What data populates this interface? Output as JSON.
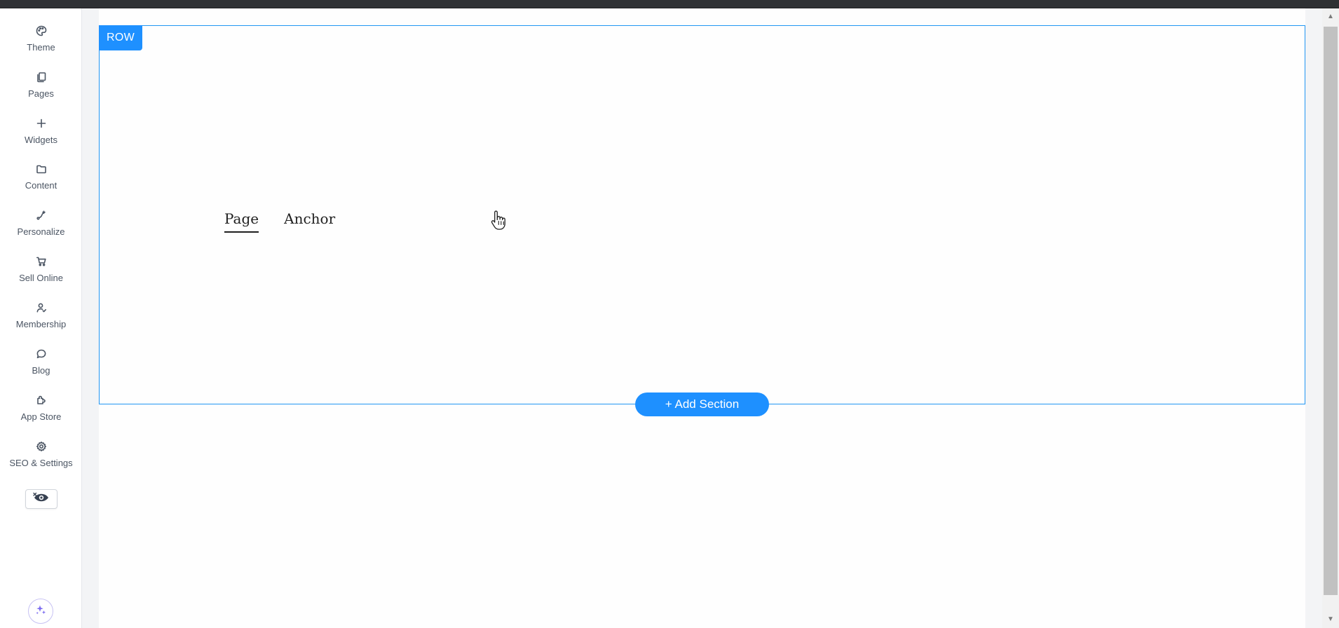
{
  "sidebar": {
    "items": [
      {
        "label": "Theme",
        "icon": "palette-icon"
      },
      {
        "label": "Pages",
        "icon": "pages-icon"
      },
      {
        "label": "Widgets",
        "icon": "plus-icon"
      },
      {
        "label": "Content",
        "icon": "folder-icon"
      },
      {
        "label": "Personalize",
        "icon": "personalize-icon"
      },
      {
        "label": "Sell Online",
        "icon": "cart-icon"
      },
      {
        "label": "Membership",
        "icon": "user-check-icon"
      },
      {
        "label": "Blog",
        "icon": "chat-bubble-icon"
      },
      {
        "label": "App Store",
        "icon": "puzzle-icon"
      },
      {
        "label": "SEO & Settings",
        "icon": "gear-icon"
      }
    ],
    "preview_icon": "eye-off-icon",
    "ai_icon": "sparkle-icon"
  },
  "canvas": {
    "row_badge": "ROW",
    "tabs": [
      {
        "label": "Page",
        "active": true
      },
      {
        "label": "Anchor",
        "active": false
      }
    ],
    "add_section_label": "+ Add Section"
  },
  "colors": {
    "accent": "#1e90ff",
    "selection_border": "#2196f3",
    "sidebar_text": "#4b5563",
    "ai_accent": "#7c6cf0"
  }
}
